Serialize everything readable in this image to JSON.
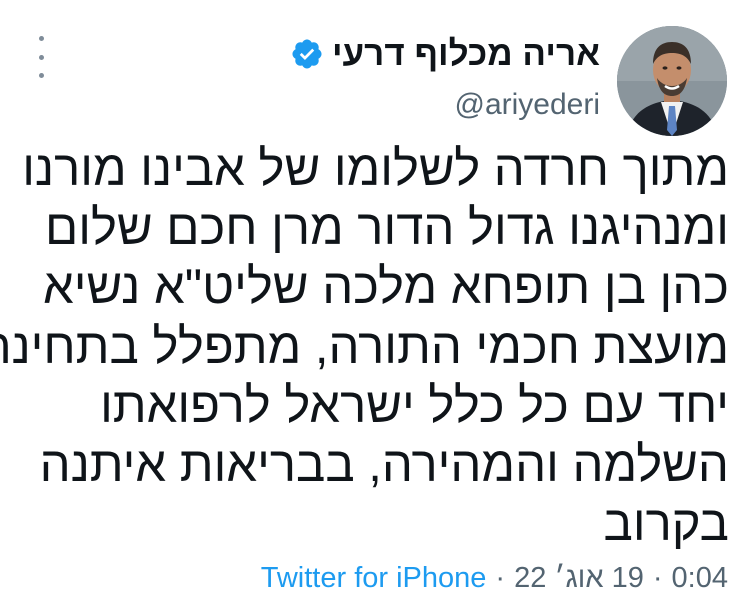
{
  "tweet": {
    "author": {
      "display_name": "אריה מכלוף דרעי",
      "handle": "@ariyederi",
      "verified_icon": "verified-badge-icon"
    },
    "menu_icon": "more-vertical-icon",
    "body_lines": [
      "מתוך חרדה לשלומו של אבינו מורנו",
      "ומנהיגנו גדול הדור מרן חכם שלום",
      "כהן בן תופחא מלכה שליט\"א נשיא",
      "מועצת חכמי התורה, מתפלל בתחינה",
      "יחד עם כל כלל ישראל לרפואתו",
      "השלמה והמהירה, בבריאות איתנה",
      "בקרוב"
    ],
    "meta": {
      "source": "Twitter for iPhone",
      "date": "19 אוג׳ 22",
      "time": "0:04",
      "separator": "·"
    }
  },
  "colors": {
    "text": "#0f1419",
    "secondary_text": "#536471",
    "accent": "#1d9bf0",
    "background": "#ffffff"
  }
}
